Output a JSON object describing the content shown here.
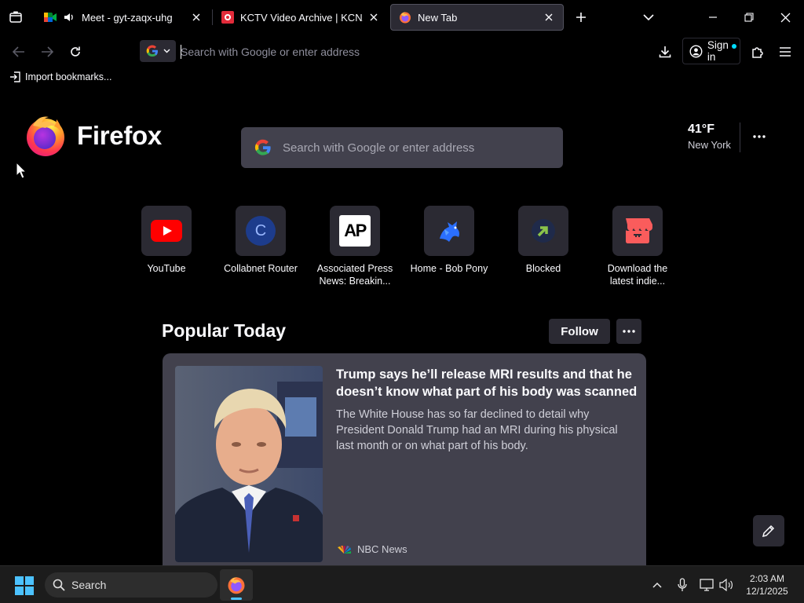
{
  "tabs": [
    {
      "title": "Meet - gyt-zaqx-uhg",
      "favicon": "google-meet-icon",
      "audio": "speaker-icon",
      "active": false
    },
    {
      "title": "KCTV Video Archive | KCNA Watch",
      "favicon": "kcna-icon",
      "active": false
    },
    {
      "title": "New Tab",
      "favicon": "firefox-icon",
      "active": true
    }
  ],
  "urlbar": {
    "placeholder": "Search with Google or enter address",
    "engine": "google-icon"
  },
  "account": {
    "signin_label": "Sign in"
  },
  "bookmarks": {
    "import_label": "Import bookmarks..."
  },
  "newtab": {
    "brand": "Firefox",
    "search_placeholder": "Search with Google or enter address",
    "weather": {
      "temp": "41°F",
      "city": "New York"
    },
    "shortcuts": [
      {
        "label": "YouTube",
        "icon": "youtube-icon"
      },
      {
        "label": "Collabnet Router",
        "icon": "letter-c-icon",
        "letter": "C"
      },
      {
        "label": "Associated Press News: Breakin...",
        "icon": "ap-icon",
        "letter": "AP"
      },
      {
        "label": "Home - Bob Pony",
        "icon": "bob-pony-icon"
      },
      {
        "label": "Blocked",
        "icon": "blocked-arrow-icon"
      },
      {
        "label": "Download the latest indie...",
        "icon": "itch-icon"
      }
    ],
    "popular": {
      "title": "Popular Today",
      "follow_label": "Follow",
      "card": {
        "headline": "Trump says he’ll release MRI results and that he doesn’t know what part of his body was scanned",
        "excerpt": "The White House has so far declined to detail why President Donald Trump had an MRI during his physical last month or on what part of his body.",
        "source": "NBC News"
      }
    }
  },
  "taskbar": {
    "search_label": "Search",
    "clock_time": "2:03 AM",
    "clock_date": "12/1/2025"
  },
  "colors": {
    "accent": "#00ddff",
    "surface": "#2b2a33",
    "card": "#42414d",
    "background": "#000000",
    "taskbar": "#1c1c1c"
  }
}
